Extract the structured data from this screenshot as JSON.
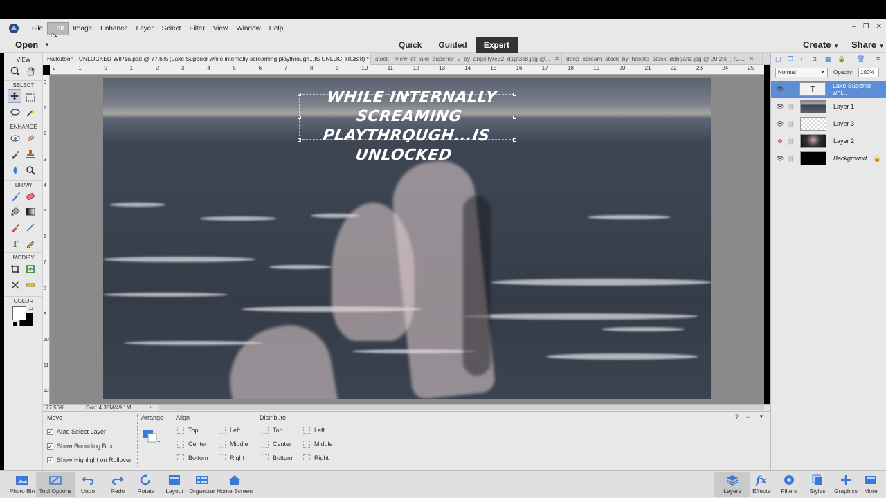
{
  "menubar": {
    "items": [
      "File",
      "Edit",
      "Image",
      "Enhance",
      "Layer",
      "Select",
      "Filter",
      "View",
      "Window",
      "Help"
    ],
    "active_index": 1,
    "window_controls": [
      "–",
      "❐",
      "✕"
    ]
  },
  "modebar": {
    "open_label": "Open",
    "modes": [
      "Quick",
      "Guided",
      "Expert"
    ],
    "selected_mode": "Expert",
    "create_label": "Create",
    "share_label": "Share"
  },
  "toolpanel": {
    "sections": [
      "VIEW",
      "SELECT",
      "ENHANCE",
      "DRAW",
      "MODIFY",
      "COLOR"
    ],
    "colors": {
      "foreground": "#ffffff",
      "background": "#000000"
    }
  },
  "doc_tabs": [
    {
      "label": "Haikutoon - UNLOCKED WIP1a.psd @ 77.6% (Lake Superior while internally screaming playthrough...IS UNLOC, RGB/8) *",
      "active": true
    },
    {
      "label": "stock__view_of_lake_superior_2_by_angelfyre32_d1gt3c8.jpg @...",
      "active": false
    },
    {
      "label": "deep_scream_stock_by_hecate_stock_d8bganz.jpg @ 20.2% (RG...",
      "active": false
    }
  ],
  "rulers": {
    "horizontal": [
      "2",
      "1",
      "0",
      "1",
      "2",
      "3",
      "4",
      "5",
      "6",
      "7",
      "8",
      "9",
      "10",
      "11",
      "12",
      "13",
      "14",
      "15",
      "16",
      "17",
      "18",
      "19",
      "20",
      "21",
      "22",
      "23",
      "24",
      "25"
    ],
    "vertical": [
      "0",
      "1",
      "2",
      "3",
      "4",
      "5",
      "6",
      "7",
      "8",
      "9",
      "10",
      "11",
      "12"
    ]
  },
  "canvas": {
    "text_line1": "WHILE INTERNALLY SCREAMING",
    "text_line2": "PLAYTHROUGH...IS UNLOCKED"
  },
  "status": {
    "zoom": "77.56%",
    "doc": "Doc: 4.38M/49.1M"
  },
  "tool_options": {
    "move_title": "Move",
    "checkboxes": [
      "Auto Select Layer",
      "Show Bounding Box",
      "Show Highlight on Rollover"
    ],
    "arrange_title": "Arrange",
    "align_title": "Align",
    "align_items": [
      "Top",
      "Center",
      "Bottom",
      "Left",
      "Middle",
      "Right"
    ],
    "distribute_title": "Distribute",
    "distribute_items": [
      "Top",
      "Center",
      "Bottom",
      "Left",
      "Middle",
      "Right"
    ]
  },
  "layers": {
    "blend_mode": "Normal",
    "opacity_label": "Opacity:",
    "opacity_value": "100%",
    "rows": [
      {
        "name": "Lake Superior whi...",
        "selected": true,
        "italic": false
      },
      {
        "name": "Layer 1",
        "selected": false,
        "italic": false
      },
      {
        "name": "Layer 3",
        "selected": false,
        "italic": false
      },
      {
        "name": "Layer 2",
        "selected": false,
        "italic": false
      },
      {
        "name": "Background",
        "selected": false,
        "italic": true
      }
    ]
  },
  "taskbar": {
    "left": [
      "Photo Bin",
      "Tool Options",
      "Undo",
      "Redo",
      "Rotate",
      "Layout",
      "Organizer",
      "Home Screen"
    ],
    "right": [
      "Layers",
      "Effects",
      "Filters",
      "Styles",
      "Graphics",
      "More"
    ]
  }
}
